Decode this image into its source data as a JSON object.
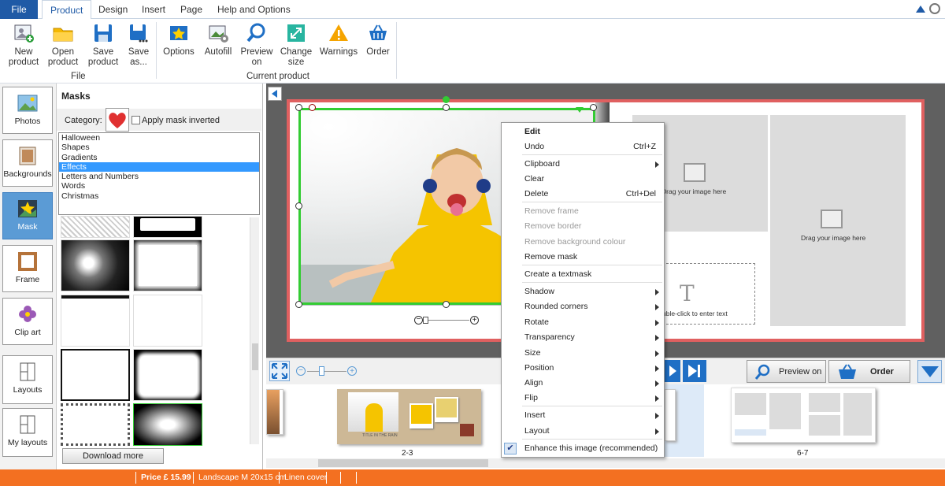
{
  "menubar": {
    "file": "File",
    "tabs": [
      "Product",
      "Design",
      "Insert",
      "Page",
      "Help and Options"
    ]
  },
  "ribbon": {
    "file_group": {
      "label": "File",
      "buttons": [
        {
          "line1": "New",
          "line2": "product"
        },
        {
          "line1": "Open",
          "line2": "product"
        },
        {
          "line1": "Save",
          "line2": "product"
        },
        {
          "line1": "Save",
          "line2": "as..."
        }
      ]
    },
    "current_group": {
      "label": "Current product",
      "buttons": [
        {
          "line1": "Options",
          "line2": ""
        },
        {
          "line1": "Autofill",
          "line2": ""
        },
        {
          "line1": "Preview",
          "line2": "on"
        },
        {
          "line1": "Change",
          "line2": "size"
        },
        {
          "line1": "Warnings",
          "line2": ""
        },
        {
          "line1": "Order",
          "line2": ""
        }
      ]
    }
  },
  "lefttabs": [
    "Photos",
    "Backgrounds",
    "Mask",
    "Frame",
    "Clip art",
    "Layouts",
    "My layouts"
  ],
  "maskpanel": {
    "title": "Masks",
    "category_label": "Category:",
    "apply_inverted": "Apply mask inverted",
    "categories": [
      "Halloween",
      "Shapes",
      "Gradients",
      "Effects",
      "Letters and Numbers",
      "Words",
      "Christmas"
    ],
    "selected": "Effects",
    "download_more": "Download more"
  },
  "canvas": {
    "drop_text_1": "Drag your image here",
    "drop_text_2": "Drag your image here",
    "text_placeholder": "uble-click to enter text"
  },
  "bottombar": {
    "preview_on": "Preview on",
    "order": "Order"
  },
  "thumbstrip": {
    "spread_label_1": "2-3",
    "spread_label_2": "6-7",
    "caption": "TITLE IN THE RAIN"
  },
  "context_menu": {
    "items": [
      {
        "label": "Edit",
        "bold": true
      },
      {
        "label": "Undo",
        "shortcut": "Ctrl+Z"
      },
      {
        "label": "Clipboard",
        "sub": true
      },
      {
        "label": "Clear"
      },
      {
        "label": "Delete",
        "shortcut": "Ctrl+Del"
      },
      {
        "label": "Remove frame",
        "disabled": true
      },
      {
        "label": "Remove border",
        "disabled": true
      },
      {
        "label": "Remove background colour",
        "disabled": true
      },
      {
        "label": "Remove mask"
      },
      {
        "label": "Create a textmask"
      },
      {
        "label": "Shadow",
        "sub": true
      },
      {
        "label": "Rounded corners",
        "sub": true
      },
      {
        "label": "Rotate",
        "sub": true
      },
      {
        "label": "Transparency",
        "sub": true
      },
      {
        "label": "Size",
        "sub": true
      },
      {
        "label": "Position",
        "sub": true
      },
      {
        "label": "Align",
        "sub": true
      },
      {
        "label": "Flip",
        "sub": true
      },
      {
        "label": "Insert",
        "sub": true
      },
      {
        "label": "Layout",
        "sub": true
      },
      {
        "label": "Enhance this image (recommended)",
        "checked": true
      }
    ]
  },
  "statusbar": {
    "price": "Price £ 15.99",
    "format": "Landscape M 20x15 cm",
    "cover": "Linen cover"
  },
  "colors": {
    "accent": "#1f5aa6",
    "status": "#f37021",
    "selection": "#3399ff",
    "frame_green": "#33cc33",
    "cover_red": "#e06060"
  }
}
